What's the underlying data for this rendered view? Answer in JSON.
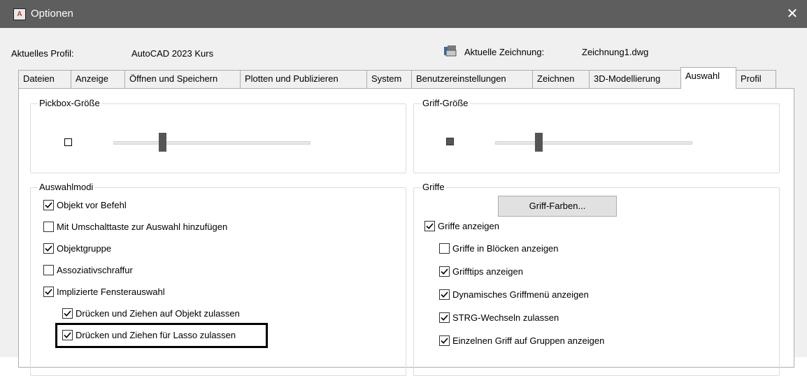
{
  "window": {
    "title": "Optionen",
    "app_icon_glyph": "A",
    "close_glyph": "✕"
  },
  "profile": {
    "label": "Aktuelles Profil:",
    "value": "AutoCAD 2023 Kurs",
    "drawing_label": "Aktuelle Zeichnung:",
    "drawing_value": "Zeichnung1.dwg"
  },
  "tabs": [
    {
      "label": "Dateien"
    },
    {
      "label": "Anzeige"
    },
    {
      "label": "Öffnen und Speichern"
    },
    {
      "label": "Plotten und Publizieren"
    },
    {
      "label": "System"
    },
    {
      "label": "Benutzereinstellungen"
    },
    {
      "label": "Zeichnen"
    },
    {
      "label": "3D-Modellierung"
    },
    {
      "label": "Auswahl",
      "active": true
    },
    {
      "label": "Profil"
    }
  ],
  "pickbox": {
    "title": "Pickbox-Größe",
    "level": 0.25
  },
  "grip_size": {
    "title": "Griff-Größe",
    "level": 0.22
  },
  "selection_modes": {
    "title": "Auswahlmodi",
    "options": [
      {
        "label": "Objekt vor Befehl",
        "checked": true
      },
      {
        "label": "Mit Umschalttaste zur Auswahl hinzufügen",
        "checked": false
      },
      {
        "label": "Objektgruppe",
        "checked": true
      },
      {
        "label": "Assoziativschraffur",
        "checked": false
      },
      {
        "label": "Implizierte Fensterauswahl",
        "checked": true
      },
      {
        "label": "Drücken und Ziehen auf Objekt zulassen",
        "checked": true
      },
      {
        "label": "Drücken und Ziehen für Lasso zulassen",
        "checked": true
      }
    ]
  },
  "grips": {
    "title": "Griffe",
    "colors_button": "Griff-Farben...",
    "options": [
      {
        "label": "Griffe anzeigen",
        "checked": true
      },
      {
        "label": "Griffe in Blöcken anzeigen",
        "checked": false
      },
      {
        "label": "Grifftips anzeigen",
        "checked": true
      },
      {
        "label": "Dynamisches Griffmenü anzeigen",
        "checked": true
      },
      {
        "label": "STRG-Wechseln zulassen",
        "checked": true
      },
      {
        "label": "Einzelnen Griff auf Gruppen anzeigen",
        "checked": true
      }
    ]
  },
  "colors": {
    "titlebar": "#5e5e5e",
    "dialog": "#f0f0f0",
    "grip_preview": "#555555"
  }
}
